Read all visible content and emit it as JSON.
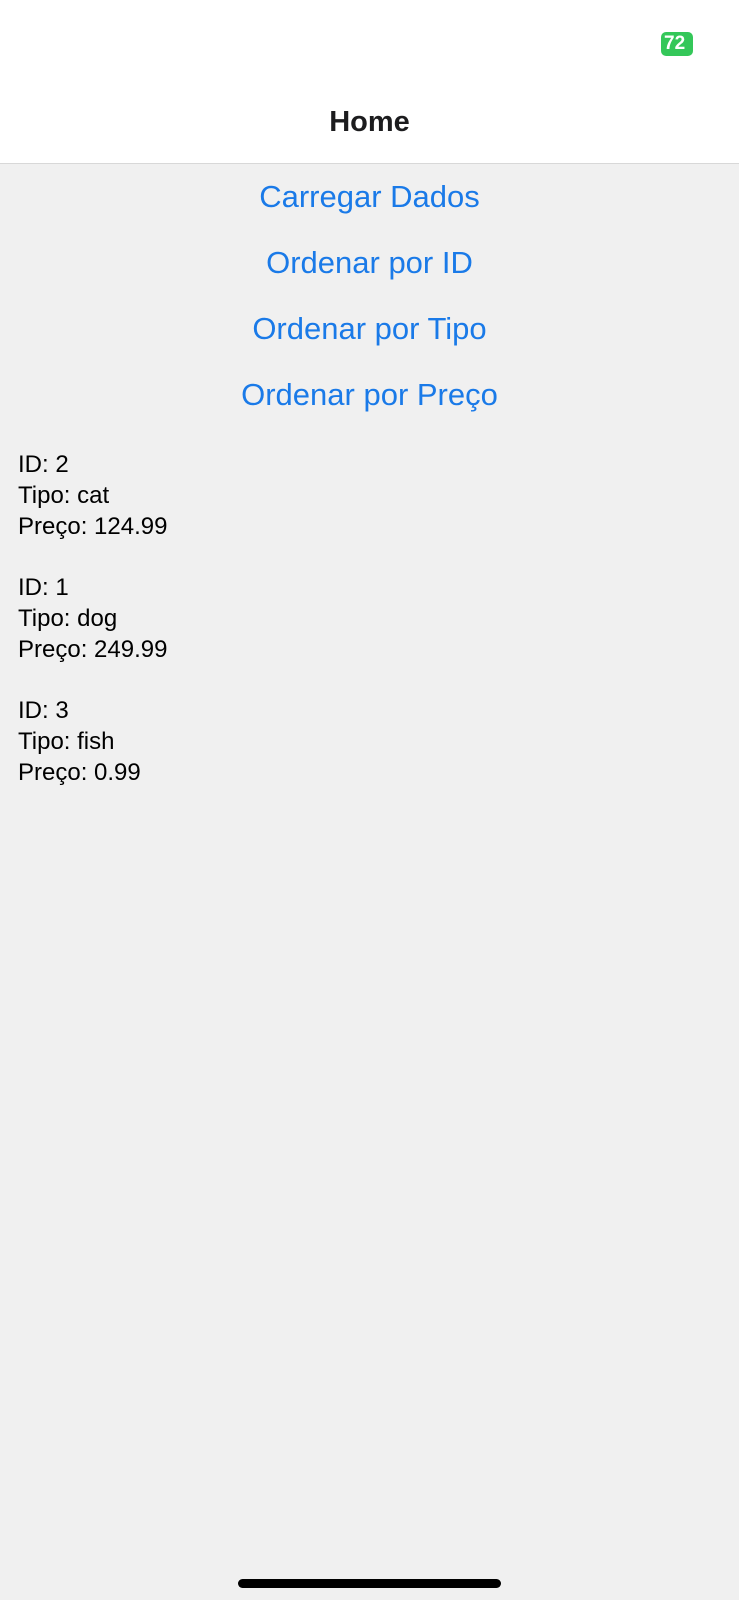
{
  "status_bar": {
    "battery_level": "72"
  },
  "nav_bar": {
    "title": "Home"
  },
  "actions": [
    {
      "label": "Carregar Dados"
    },
    {
      "label": "Ordenar por ID"
    },
    {
      "label": "Ordenar por Tipo"
    },
    {
      "label": "Ordenar por Preço"
    }
  ],
  "pets": [
    {
      "id_line": "ID: 2",
      "tipo_line": "Tipo: cat",
      "preco_line": "Preço: 124.99"
    },
    {
      "id_line": "ID: 1",
      "tipo_line": "Tipo: dog",
      "preco_line": "Preço: 249.99"
    },
    {
      "id_line": "ID: 3",
      "tipo_line": "Tipo: fish",
      "preco_line": "Preço: 0.99"
    }
  ],
  "colors": {
    "accent": "#1a7ae8",
    "battery": "#34c759",
    "background": "#f0f0f0"
  }
}
